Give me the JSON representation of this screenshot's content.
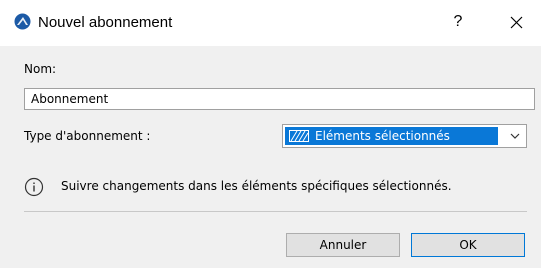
{
  "window": {
    "title": "Nouvel abonnement",
    "help_label": "?",
    "close_label": "close"
  },
  "form": {
    "name_label": "Nom:",
    "name_value": "Abonnement",
    "type_label": "Type d'abonnement :",
    "type_selected": "Eléments sélectionnés",
    "info_text": "Suivre changements dans les éléments spécifiques sélectionnés."
  },
  "buttons": {
    "cancel": "Annuler",
    "ok": "OK"
  },
  "colors": {
    "selection": "#0a78d7",
    "ok_border": "#0078d7",
    "app_icon": "#1c5aa6"
  },
  "icons": {
    "app": "archicad-icon",
    "help": "help-icon",
    "close": "close-icon",
    "pattern": "hatch-pattern-icon",
    "dropdown": "chevron-down-icon",
    "info": "info-icon"
  }
}
